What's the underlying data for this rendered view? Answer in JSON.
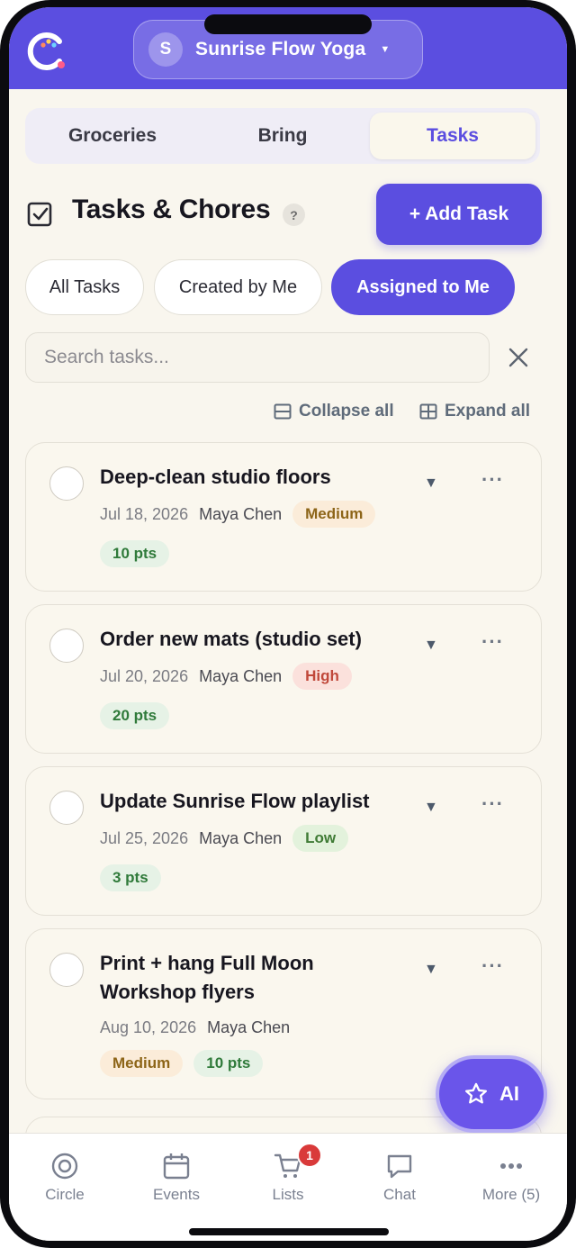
{
  "header": {
    "circle_initial": "S",
    "circle_name": "Sunrise Flow Yoga",
    "brand_color": "#5b4ee0"
  },
  "tabs": [
    {
      "label": "Groceries",
      "active": false
    },
    {
      "label": "Bring",
      "active": false
    },
    {
      "label": "Tasks",
      "active": true
    }
  ],
  "section": {
    "title": "Tasks & Chores",
    "help": "?",
    "add_task_label": "+ Add Task"
  },
  "filters": [
    {
      "label": "All Tasks",
      "active": false
    },
    {
      "label": "Created by Me",
      "active": false
    },
    {
      "label": "Assigned to Me",
      "active": true
    }
  ],
  "search": {
    "placeholder": "Search tasks...",
    "value": ""
  },
  "controls": {
    "collapse_label": "Collapse all",
    "expand_label": "Expand all"
  },
  "tasks": [
    {
      "title": "Deep-clean studio floors",
      "date": "Jul 18, 2026",
      "owner": "Maya Chen",
      "priority": "Medium",
      "points": "10 pts"
    },
    {
      "title": "Order new mats (studio set)",
      "date": "Jul 20, 2026",
      "owner": "Maya Chen",
      "priority": "High",
      "points": "20 pts"
    },
    {
      "title": "Update Sunrise Flow playlist",
      "date": "Jul 25, 2026",
      "owner": "Maya Chen",
      "priority": "Low",
      "points": "3 pts"
    },
    {
      "title": "Print + hang Full Moon Workshop flyers",
      "date": "Aug 10, 2026",
      "owner": "Maya Chen",
      "priority": "Medium",
      "points": "10 pts"
    }
  ],
  "ai_button": "AI",
  "bottom_nav": [
    {
      "label": "Circle",
      "icon": "target-icon"
    },
    {
      "label": "Events",
      "icon": "calendar-icon"
    },
    {
      "label": "Lists",
      "icon": "cart-icon",
      "badge": "1"
    },
    {
      "label": "Chat",
      "icon": "chat-icon"
    },
    {
      "label": "More (5)",
      "icon": "more-icon"
    }
  ]
}
